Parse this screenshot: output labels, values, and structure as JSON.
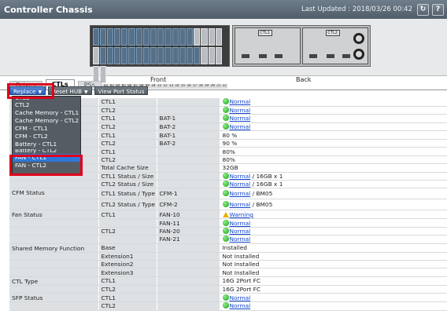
{
  "header": {
    "title": "Controller Chassis",
    "last_updated": "Last Updated : 2018/03/26 00:42",
    "refresh_symbol": "↻",
    "help_symbol": "?"
  },
  "chassis": {
    "front_label": "Front",
    "back_label": "Back",
    "slot_numbers": "00 01 02 03 04 05 06 07 08 09 10 11 12 13 14 15 16 17 18 19 20 21 22 23",
    "ctl1_label": "CTL1",
    "ctl2_label": "CTL2"
  },
  "tabs": [
    "Drives",
    "CTLs",
    "PSs"
  ],
  "toolbar": {
    "replace": "Replace",
    "reset_hub": "Reset HUB",
    "view_port_status": "View Port Status"
  },
  "replace_menu": [
    "CTL1",
    "CTL2",
    "Cache Memory - CTL1",
    "Cache Memory - CTL2",
    "CFM - CTL1",
    "CFM - CTL2",
    "Battery - CTL1",
    "Battery - CTL2",
    "FAN - CTL1",
    "FAN - CTL2"
  ],
  "table": {
    "rows": [
      {
        "item": "",
        "ctl": "CTL1",
        "sub": "",
        "value": "Normal",
        "status": "ok"
      },
      {
        "item": "",
        "ctl": "CTL2",
        "sub": "",
        "value": "Normal",
        "status": "ok"
      },
      {
        "item": "",
        "ctl": "CTL1",
        "sub": "BAT-1",
        "value": "Normal",
        "status": "ok"
      },
      {
        "item": "",
        "ctl": "CTL2",
        "sub": "BAT-2",
        "value": "Normal",
        "status": "ok"
      },
      {
        "item": "ing",
        "ctl": "CTL1",
        "sub": "BAT-1",
        "value": "80 %",
        "status": ""
      },
      {
        "item": "",
        "ctl": "CTL2",
        "sub": "BAT-2",
        "value": "90 %",
        "status": ""
      },
      {
        "item": "",
        "ctl": "CTL1",
        "sub": "",
        "value": "80%",
        "status": ""
      },
      {
        "item": "",
        "ctl": "CTL2",
        "sub": "",
        "value": "80%",
        "status": ""
      },
      {
        "item": "",
        "ctl": "Total Cache Size",
        "sub": "",
        "value": "32GB",
        "status": ""
      },
      {
        "item": "",
        "ctl": "CTL1 Status / Size",
        "sub": "",
        "value": "Normal",
        "suffix": " / 16GB x 1",
        "status": "ok"
      },
      {
        "item": "",
        "ctl": "CTL2 Status / Size",
        "sub": "",
        "value": "Normal",
        "suffix": " / 16GB x 1",
        "status": "ok"
      },
      {
        "item": "CFM Status",
        "ctl": "CTL1 Status / Type",
        "sub": "CFM-1",
        "value": "Normal",
        "suffix": " / BM05",
        "status": "ok"
      },
      {
        "item": "",
        "ctl": "CTL2 Status / Type",
        "sub": "CFM-2",
        "value": "Normal",
        "suffix": " / BM05",
        "status": "ok"
      },
      {
        "item": "Fan Status",
        "ctl": "CTL1",
        "sub": "FAN-10",
        "value": "Warning",
        "status": "warn"
      },
      {
        "item": "",
        "ctl": "",
        "sub": "FAN-11",
        "value": "Normal",
        "status": "ok"
      },
      {
        "item": "",
        "ctl": "CTL2",
        "sub": "FAN-20",
        "value": "Normal",
        "status": "ok"
      },
      {
        "item": "",
        "ctl": "",
        "sub": "FAN-21",
        "value": "Normal",
        "status": "ok"
      },
      {
        "item": "Shared Memory Function",
        "ctl": "Base",
        "sub": "",
        "value": "Installed",
        "status": ""
      },
      {
        "item": "",
        "ctl": "Extension1",
        "sub": "",
        "value": "Not Installed",
        "status": ""
      },
      {
        "item": "",
        "ctl": "Extension2",
        "sub": "",
        "value": "Not Installed",
        "status": ""
      },
      {
        "item": "",
        "ctl": "Extension3",
        "sub": "",
        "value": "Not Installed",
        "status": ""
      },
      {
        "item": "CTL Type",
        "ctl": "CTL1",
        "sub": "",
        "value": "16G 2Port FC",
        "status": ""
      },
      {
        "item": "",
        "ctl": "CTL2",
        "sub": "",
        "value": "16G 2Port FC",
        "status": ""
      },
      {
        "item": "SFP Status",
        "ctl": "CTL1",
        "sub": "",
        "value": "Normal",
        "status": "ok"
      },
      {
        "item": "",
        "ctl": "CTL2",
        "sub": "",
        "value": "Normal",
        "status": "ok"
      }
    ]
  },
  "colors": {
    "header_bg": "#5f6d79",
    "link": "#1144cc",
    "ok": "#1a9a1a",
    "warn": "#e8b000",
    "highlight_box": "#e0001a",
    "menu_selected": "#2e77d8"
  }
}
